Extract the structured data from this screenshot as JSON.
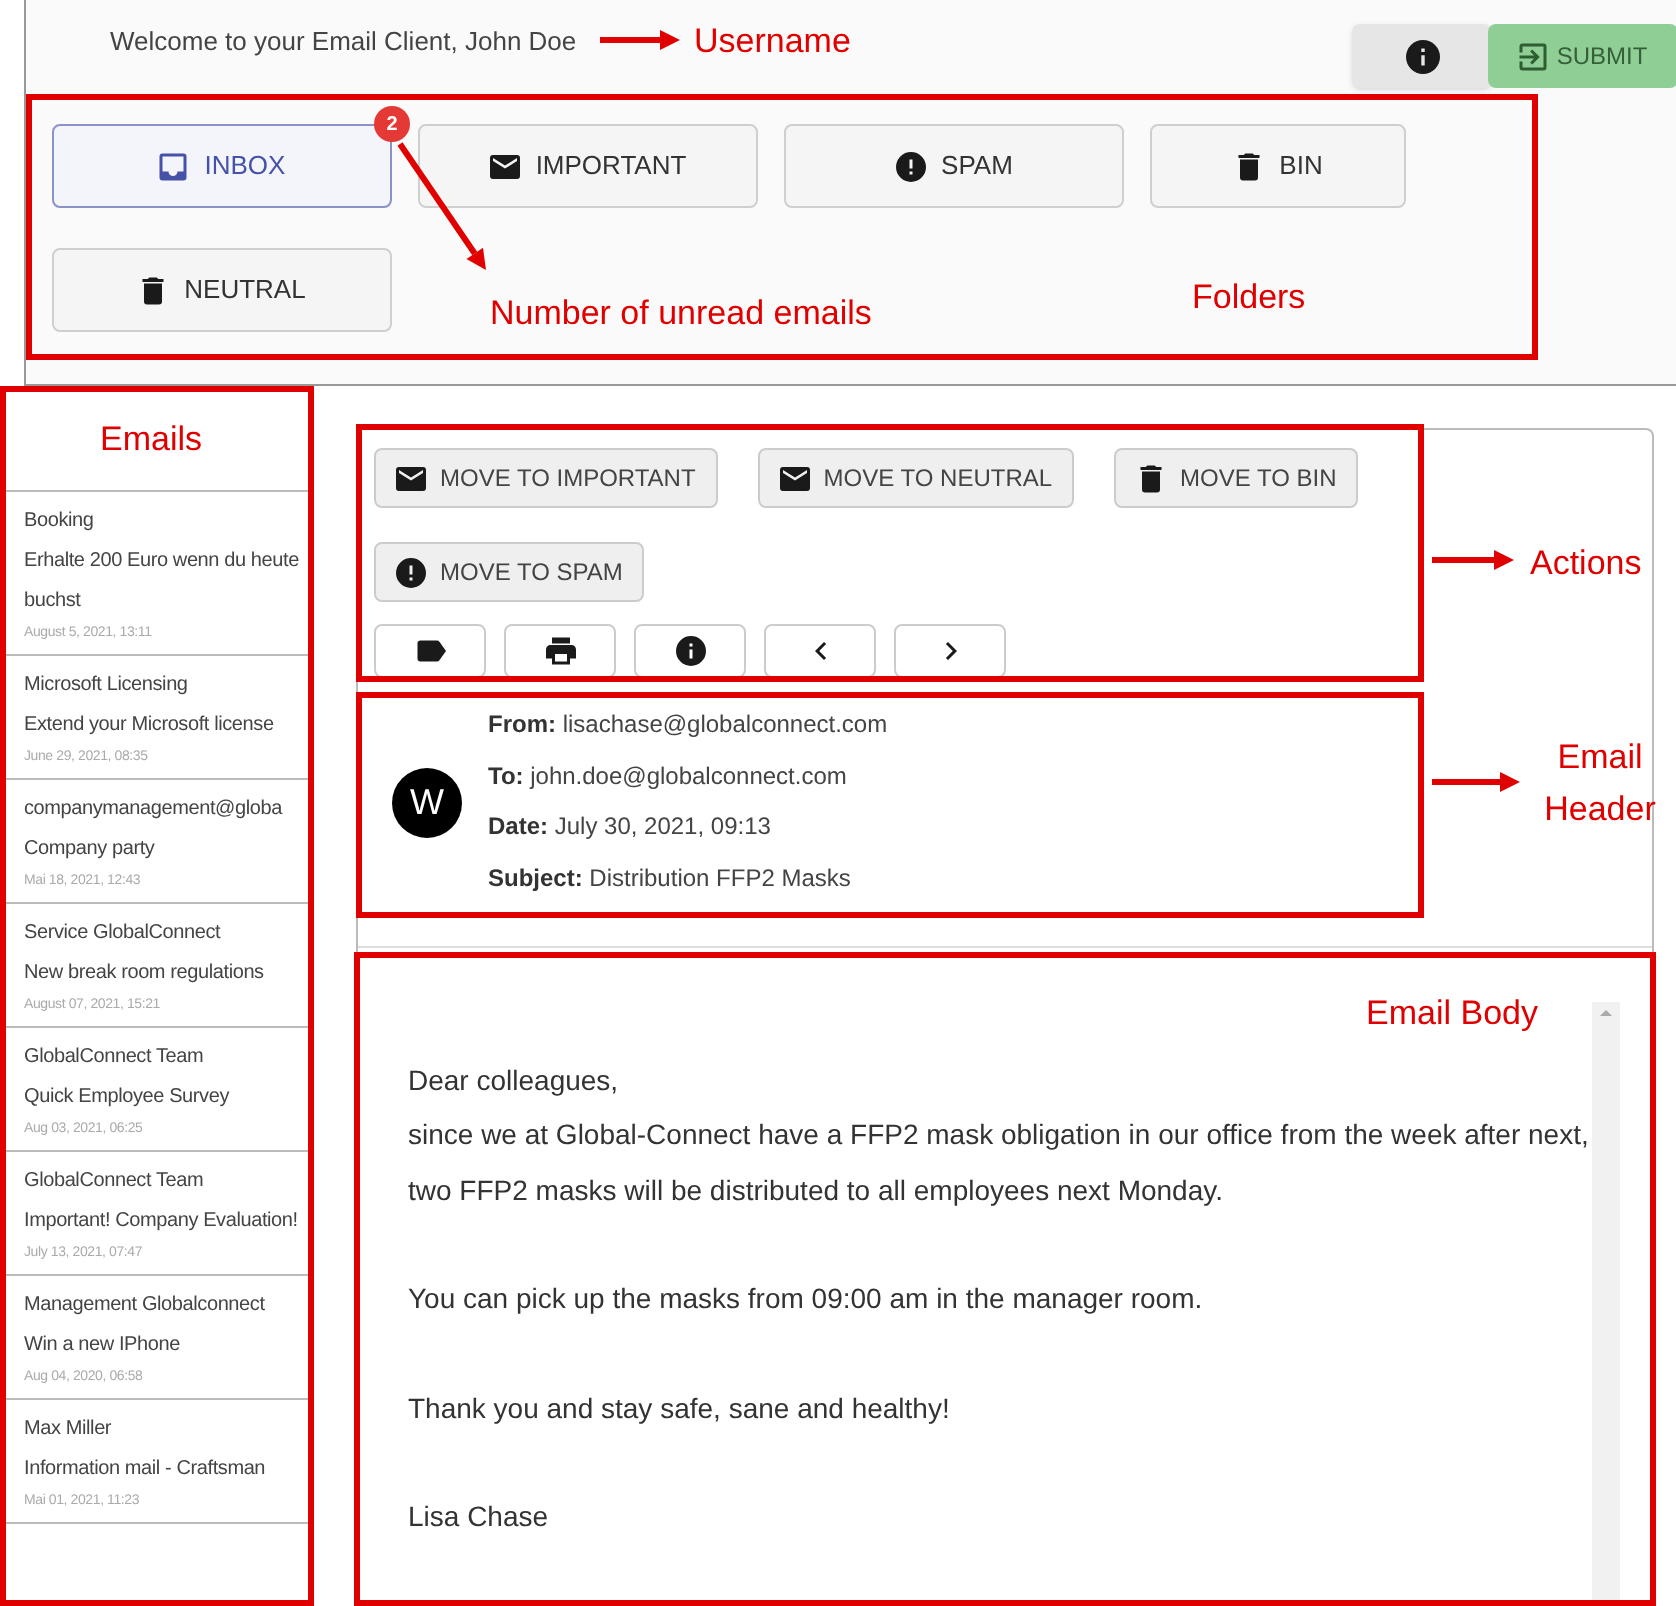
{
  "top_bar": {
    "welcome": "Welcome to your Email Client, John Doe",
    "buttons": [
      {
        "kind": "info"
      },
      {
        "kind": "submit",
        "label": "SUBMIT"
      }
    ]
  },
  "folders": [
    {
      "label": "INBOX",
      "kind": "inbox",
      "selected": true,
      "badge": "2"
    },
    {
      "label": "IMPORTANT",
      "kind": "mail",
      "selected": false
    },
    {
      "label": "SPAM",
      "kind": "alert",
      "selected": false
    },
    {
      "label": "BIN",
      "kind": "trash",
      "selected": false
    },
    {
      "label": "NEUTRAL",
      "kind": "trash",
      "selected": false
    }
  ],
  "emails": [
    {
      "sender": "Booking",
      "subject": "Erhalte 200 Euro wenn du heute buchst",
      "date": "August 5, 2021, 13:11"
    },
    {
      "sender": "Microsoft Licensing",
      "subject": "Extend your Microsoft license",
      "date": "June 29, 2021, 08:35"
    },
    {
      "sender": "companymanagement@globa",
      "subject": "Company party",
      "date": "Mai 18, 2021, 12:43"
    },
    {
      "sender": "Service GlobalConnect",
      "subject": "New break room regulations",
      "date": "August 07, 2021, 15:21"
    },
    {
      "sender": "GlobalConnect Team",
      "subject": "Quick Employee Survey",
      "date": "Aug 03, 2021, 06:25"
    },
    {
      "sender": "GlobalConnect Team",
      "subject": "Important! Company Evaluation!",
      "date": "July 13, 2021, 07:47"
    },
    {
      "sender": "Management Globalconnect",
      "subject": "Win a new IPhone",
      "date": "Aug 04, 2020, 06:58"
    },
    {
      "sender": "Max Miller",
      "subject": "Information mail - Craftsman",
      "date": "Mai 01, 2021, 11:23"
    }
  ],
  "actions": [
    {
      "label": "MOVE TO IMPORTANT",
      "kind": "mail"
    },
    {
      "label": "MOVE TO NEUTRAL",
      "kind": "mail"
    },
    {
      "label": "MOVE TO BIN",
      "kind": "trash"
    },
    {
      "label": "MOVE TO SPAM",
      "kind": "alert"
    }
  ],
  "tool_buttons": [
    {
      "kind": "label"
    },
    {
      "kind": "print"
    },
    {
      "kind": "info"
    },
    {
      "kind": "prev"
    },
    {
      "kind": "next"
    }
  ],
  "email_header": {
    "avatar": "W",
    "fields": [
      {
        "label": "From:",
        "value": "lisachase@globalconnect.com"
      },
      {
        "label": "To:",
        "value": "john.doe@globalconnect.com"
      },
      {
        "label": "Date:",
        "value": "July 30, 2021, 09:13"
      },
      {
        "label": "Subject:",
        "value": "Distribution FFP2 Masks"
      }
    ]
  },
  "email_body": [
    [
      "Dear colleagues,",
      "since we at Global-Connect have a FFP2 mask obligation in our office from the week after next,",
      "two FFP2 masks will be distributed to all employees next Monday."
    ],
    [
      "You can pick up the masks from 09:00 am in the manager room."
    ],
    [
      "Thank you and stay safe, sane and healthy!"
    ],
    [
      "Lisa Chase"
    ]
  ],
  "annotations": [
    {
      "text": "Username",
      "kind": "arrow-label"
    },
    {
      "text": "Number of unread emails",
      "kind": "arrow-label"
    },
    {
      "text": "Folders",
      "kind": "box-label"
    },
    {
      "text": "Emails",
      "kind": "box-label"
    },
    {
      "text": "Actions",
      "kind": "arrow-label"
    },
    {
      "text": "Email Header",
      "kind": "arrow-label"
    },
    {
      "text": "Email Body",
      "kind": "box-label"
    }
  ]
}
